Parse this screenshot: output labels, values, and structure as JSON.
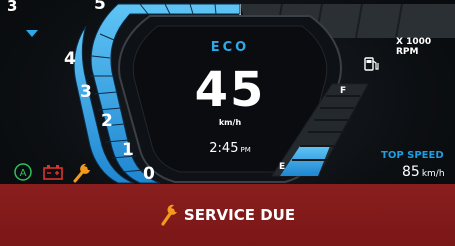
{
  "speed": {
    "value": "45",
    "unit": "km/h",
    "mode": "ECO"
  },
  "clock": {
    "time": "2:45",
    "meridiem": "PM"
  },
  "tachometer": {
    "scale_label": "X 1000 RPM",
    "ticks": [
      "0",
      "1",
      "2",
      "3",
      "4",
      "5"
    ]
  },
  "fuel": {
    "full_label": "F",
    "empty_label": "E",
    "level": 0.3
  },
  "top_speed": {
    "label": "TOP SPEED",
    "value": "85",
    "unit": "km/h"
  },
  "gear": {
    "value": "3"
  },
  "indicators": [
    "abs-icon",
    "battery-warning-icon",
    "service-wrench-icon"
  ],
  "alert": {
    "text": "SERVICE DUE"
  },
  "colors": {
    "accent": "#2ea9e8",
    "alert_red": "#8a1e1e",
    "warning_orange": "#f39a1c",
    "abs_green": "#2ec35a",
    "battery_red": "#e0322c"
  }
}
